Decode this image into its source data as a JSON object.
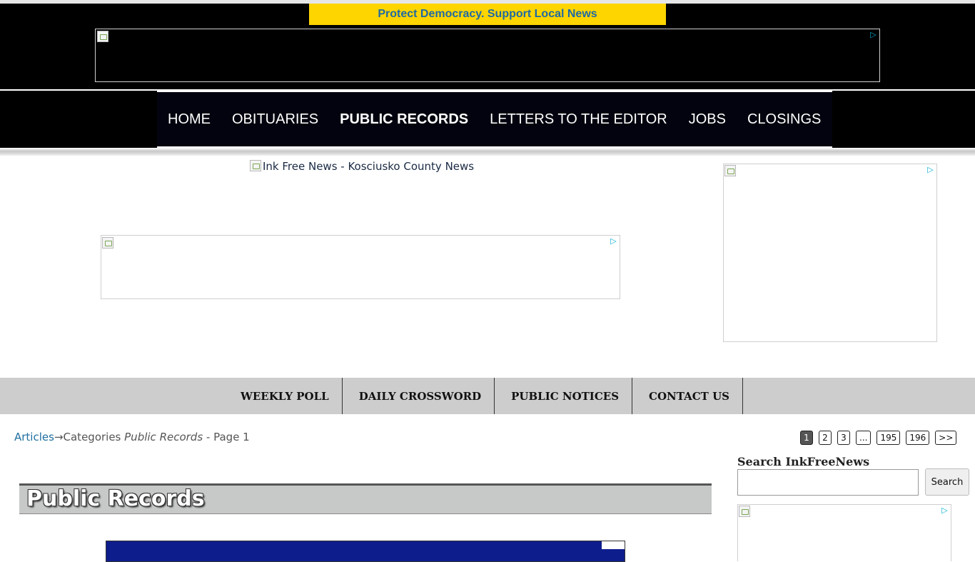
{
  "promo_banner": {
    "text": "Protect Democracy. Support Local News"
  },
  "main_nav": {
    "items": [
      {
        "label": "HOME"
      },
      {
        "label": "OBITUARIES"
      },
      {
        "label": "PUBLIC RECORDS",
        "active": true
      },
      {
        "label": "LETTERS TO THE EDITOR"
      },
      {
        "label": "JOBS"
      },
      {
        "label": "CLOSINGS"
      }
    ]
  },
  "logo": {
    "alt_text": "Ink Free News - Kosciusko County News"
  },
  "sub_nav": {
    "items": [
      {
        "label": "WEEKLY POLL"
      },
      {
        "label": "DAILY CROSSWORD"
      },
      {
        "label": "PUBLIC NOTICES"
      },
      {
        "label": "CONTACT US"
      }
    ]
  },
  "breadcrumb": {
    "link": "Articles",
    "arrow": "→",
    "categories": "Categories ",
    "category_name": "Public Records",
    "page_suffix": " - Page 1"
  },
  "pagination": {
    "pages": [
      "1",
      "2",
      "3",
      "...",
      "195",
      "196",
      ">>"
    ],
    "current": "1"
  },
  "search": {
    "label": "Search InkFreeNews",
    "input_value": "",
    "button_label": "Search"
  },
  "section": {
    "title": "Public Records"
  },
  "icons": {
    "ad_choices": "adchoices-icon",
    "broken_image": "broken-image-icon"
  },
  "colors": {
    "promo_bg": "#ffd500",
    "promo_text": "#1e6aa3",
    "header_bg": "#000000",
    "subnav_bg": "#cdcdcd",
    "link": "#1f6ea0",
    "section_bar": "#c7c9c8"
  }
}
